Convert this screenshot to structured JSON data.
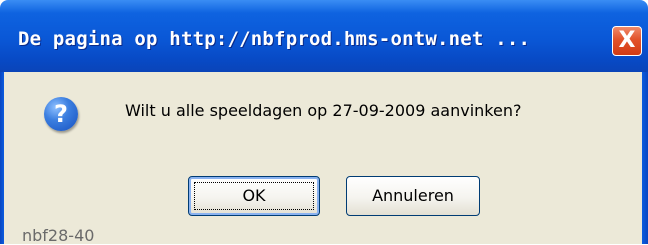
{
  "dialog": {
    "title": "De pagina op http://nbfprod.hms-ontw.net ...",
    "close_label": "X",
    "icon": "question-icon",
    "icon_glyph": "?",
    "message": "Wilt u alle speeldagen op 27-09-2009 aanvinken?",
    "ok_label": "OK",
    "cancel_label": "Annuleren"
  },
  "background": {
    "status_text": "nbf28-40"
  },
  "colors": {
    "titlebar": "#0a57d6",
    "client": "#ece9d8",
    "close_button": "#d23b14",
    "button_border": "#003c74"
  }
}
